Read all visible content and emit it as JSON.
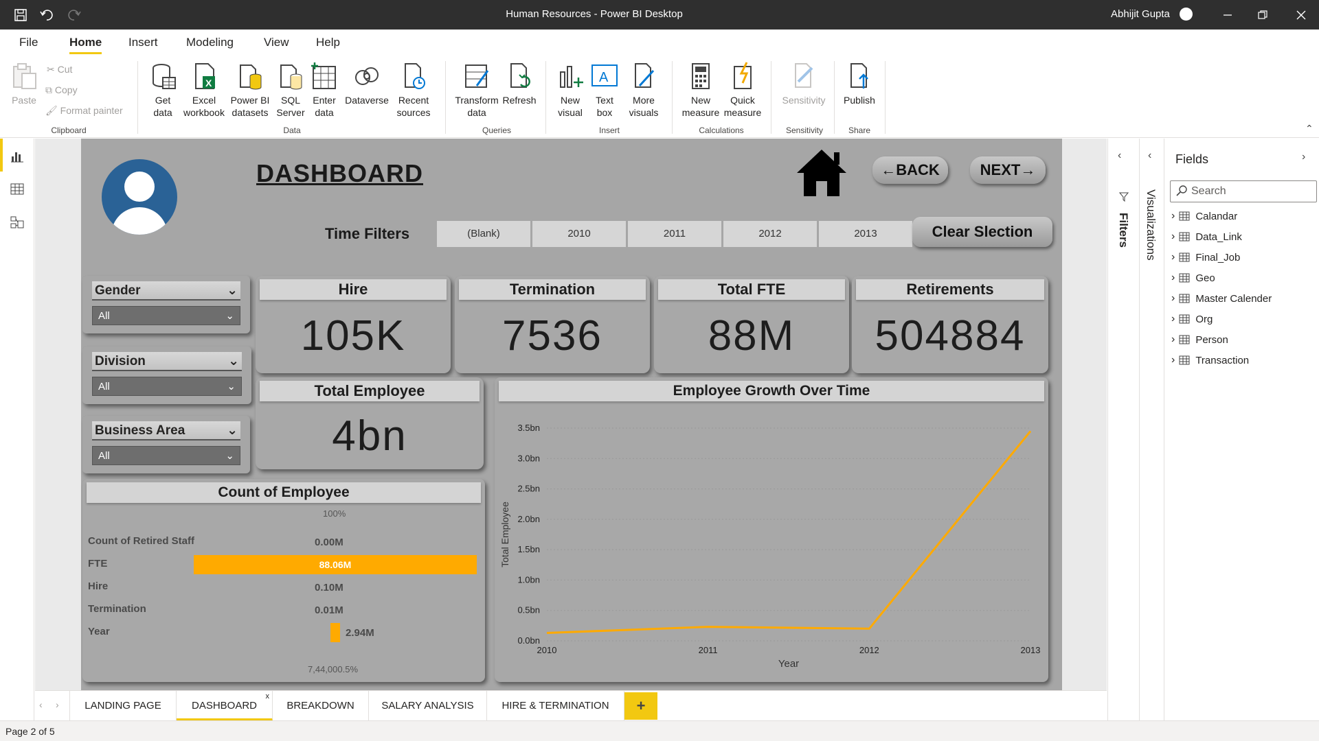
{
  "window": {
    "title": "Human Resources - Power BI Desktop",
    "user": "Abhijit Gupta"
  },
  "menu": {
    "items": [
      "File",
      "Home",
      "Insert",
      "Modeling",
      "View",
      "Help"
    ],
    "active": "Home"
  },
  "ribbon": {
    "clipboard": {
      "paste": "Paste",
      "cut": "Cut",
      "copy": "Copy",
      "format_painter": "Format painter",
      "label": "Clipboard"
    },
    "data": {
      "get_data": "Get data",
      "excel": "Excel workbook",
      "pbi": "Power BI datasets",
      "sql": "SQL Server",
      "enter": "Enter data",
      "dataverse": "Dataverse",
      "recent": "Recent sources",
      "label": "Data"
    },
    "queries": {
      "transform": "Transform data",
      "refresh": "Refresh",
      "label": "Queries"
    },
    "insert": {
      "new_visual": "New visual",
      "text_box": "Text box",
      "more_visuals": "More visuals",
      "label": "Insert"
    },
    "calculations": {
      "new_measure": "New measure",
      "quick_measure": "Quick measure",
      "label": "Calculations"
    },
    "sensitivity": {
      "btn": "Sensitivity",
      "label": "Sensitivity"
    },
    "share": {
      "publish": "Publish",
      "label": "Share"
    }
  },
  "report": {
    "title": "DASHBOARD",
    "back": "BACK",
    "next": "NEXT",
    "time_filters_label": "Time Filters",
    "time_filters": [
      "(Blank)",
      "2010",
      "2011",
      "2012",
      "2013"
    ],
    "clear_selection": "Clear Slection",
    "slicers": [
      {
        "name": "Gender",
        "value": "All"
      },
      {
        "name": "Division",
        "value": "All"
      },
      {
        "name": "Business Area",
        "value": "All"
      }
    ],
    "kpis": [
      {
        "title": "Hire",
        "value": "105K"
      },
      {
        "title": "Termination",
        "value": "7536"
      },
      {
        "title": "Total FTE",
        "value": "88M"
      },
      {
        "title": "Retirements",
        "value": "504884"
      }
    ],
    "total_employee": {
      "title": "Total Employee",
      "value": "4bn"
    },
    "count_of_employee": {
      "title": "Count of Employee",
      "top_label": "100%",
      "bottom_label": "7,44,000.5%",
      "rows": [
        {
          "label": "Count of Retired Staff",
          "value": "0.00M",
          "fraction": 0.0
        },
        {
          "label": "FTE",
          "value": "88.06M",
          "fraction": 1.0
        },
        {
          "label": "Hire",
          "value": "0.10M",
          "fraction": 0.001
        },
        {
          "label": "Termination",
          "value": "0.01M",
          "fraction": 0.0001
        },
        {
          "label": "Year",
          "value": "2.94M",
          "fraction": 0.033
        }
      ],
      "bar_color": "#ffaa00"
    }
  },
  "chart_data": {
    "type": "line",
    "title": "Employee Growth Over Time",
    "xlabel": "Year",
    "ylabel": "Total Employee",
    "x": [
      "2010",
      "2011",
      "2012",
      "2013"
    ],
    "y_ticks": [
      "0.0bn",
      "0.5bn",
      "1.0bn",
      "1.5bn",
      "2.0bn",
      "2.5bn",
      "3.0bn",
      "3.5bn"
    ],
    "ylim": [
      0,
      3.5
    ],
    "series": [
      {
        "values": [
          0.13,
          0.23,
          0.2,
          3.45
        ],
        "color": "#ffaa00"
      }
    ]
  },
  "panes": {
    "filters": "Filters",
    "visualizations": "Visualizations",
    "fields_title": "Fields",
    "search_placeholder": "Search",
    "tables": [
      "Calandar",
      "Data_Link",
      "Final_Job",
      "Geo",
      "Master Calender",
      "Org",
      "Person",
      "Transaction"
    ]
  },
  "tabs": [
    "LANDING PAGE",
    "DASHBOARD",
    "BREAKDOWN",
    "SALARY ANALYSIS",
    "HIRE & TERMINATION"
  ],
  "active_tab": "DASHBOARD",
  "add_page": "+",
  "status": "Page 2 of 5"
}
